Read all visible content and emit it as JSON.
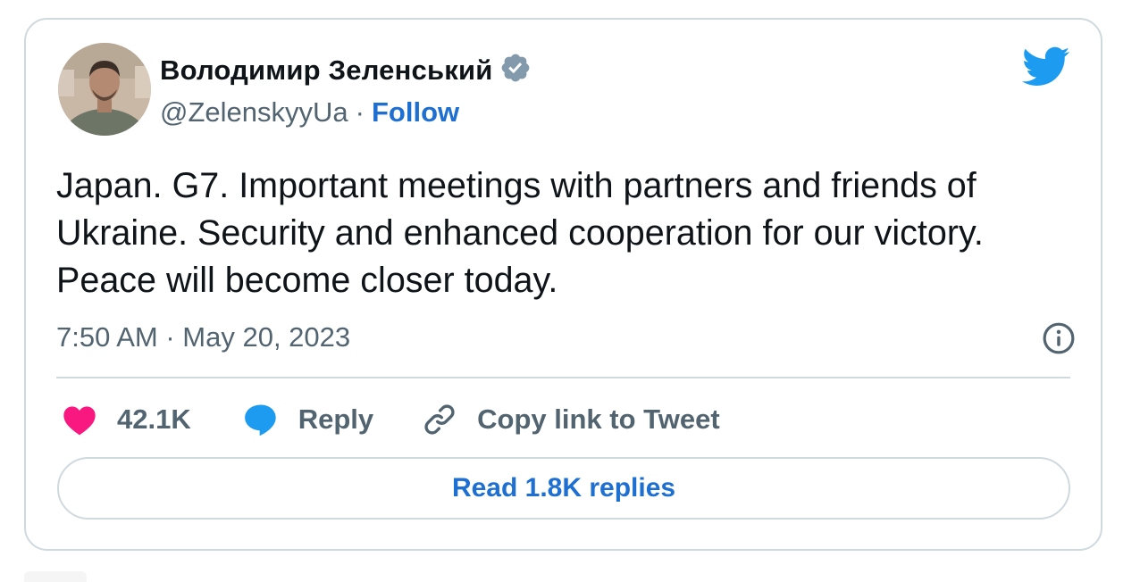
{
  "author": {
    "name": "Володимир Зеленський",
    "handle": "@ZelenskyyUa",
    "separator": "·",
    "follow_label": "Follow",
    "verified": true
  },
  "tweet": {
    "text": "Japan. G7. Important meetings with partners and friends of Ukraine. Security and enhanced cooperation for our victory. Peace will become closer today.",
    "timestamp": "7:50 AM · May 20, 2023"
  },
  "actions": {
    "like_count": "42.1K",
    "reply_label": "Reply",
    "copy_link_label": "Copy link to Tweet"
  },
  "footer": {
    "read_replies_label": "Read 1.8K replies"
  },
  "colors": {
    "accent": "#1d6fd1",
    "twitter_blue": "#1d9bf0",
    "like_red": "#f91880",
    "muted_text": "#536471",
    "border": "#cfd9de"
  },
  "icons": {
    "verified": "verified-badge-icon",
    "bird": "twitter-bird-icon",
    "info": "info-icon",
    "like": "heart-icon",
    "reply": "speech-bubble-icon",
    "copy_link": "link-icon"
  }
}
